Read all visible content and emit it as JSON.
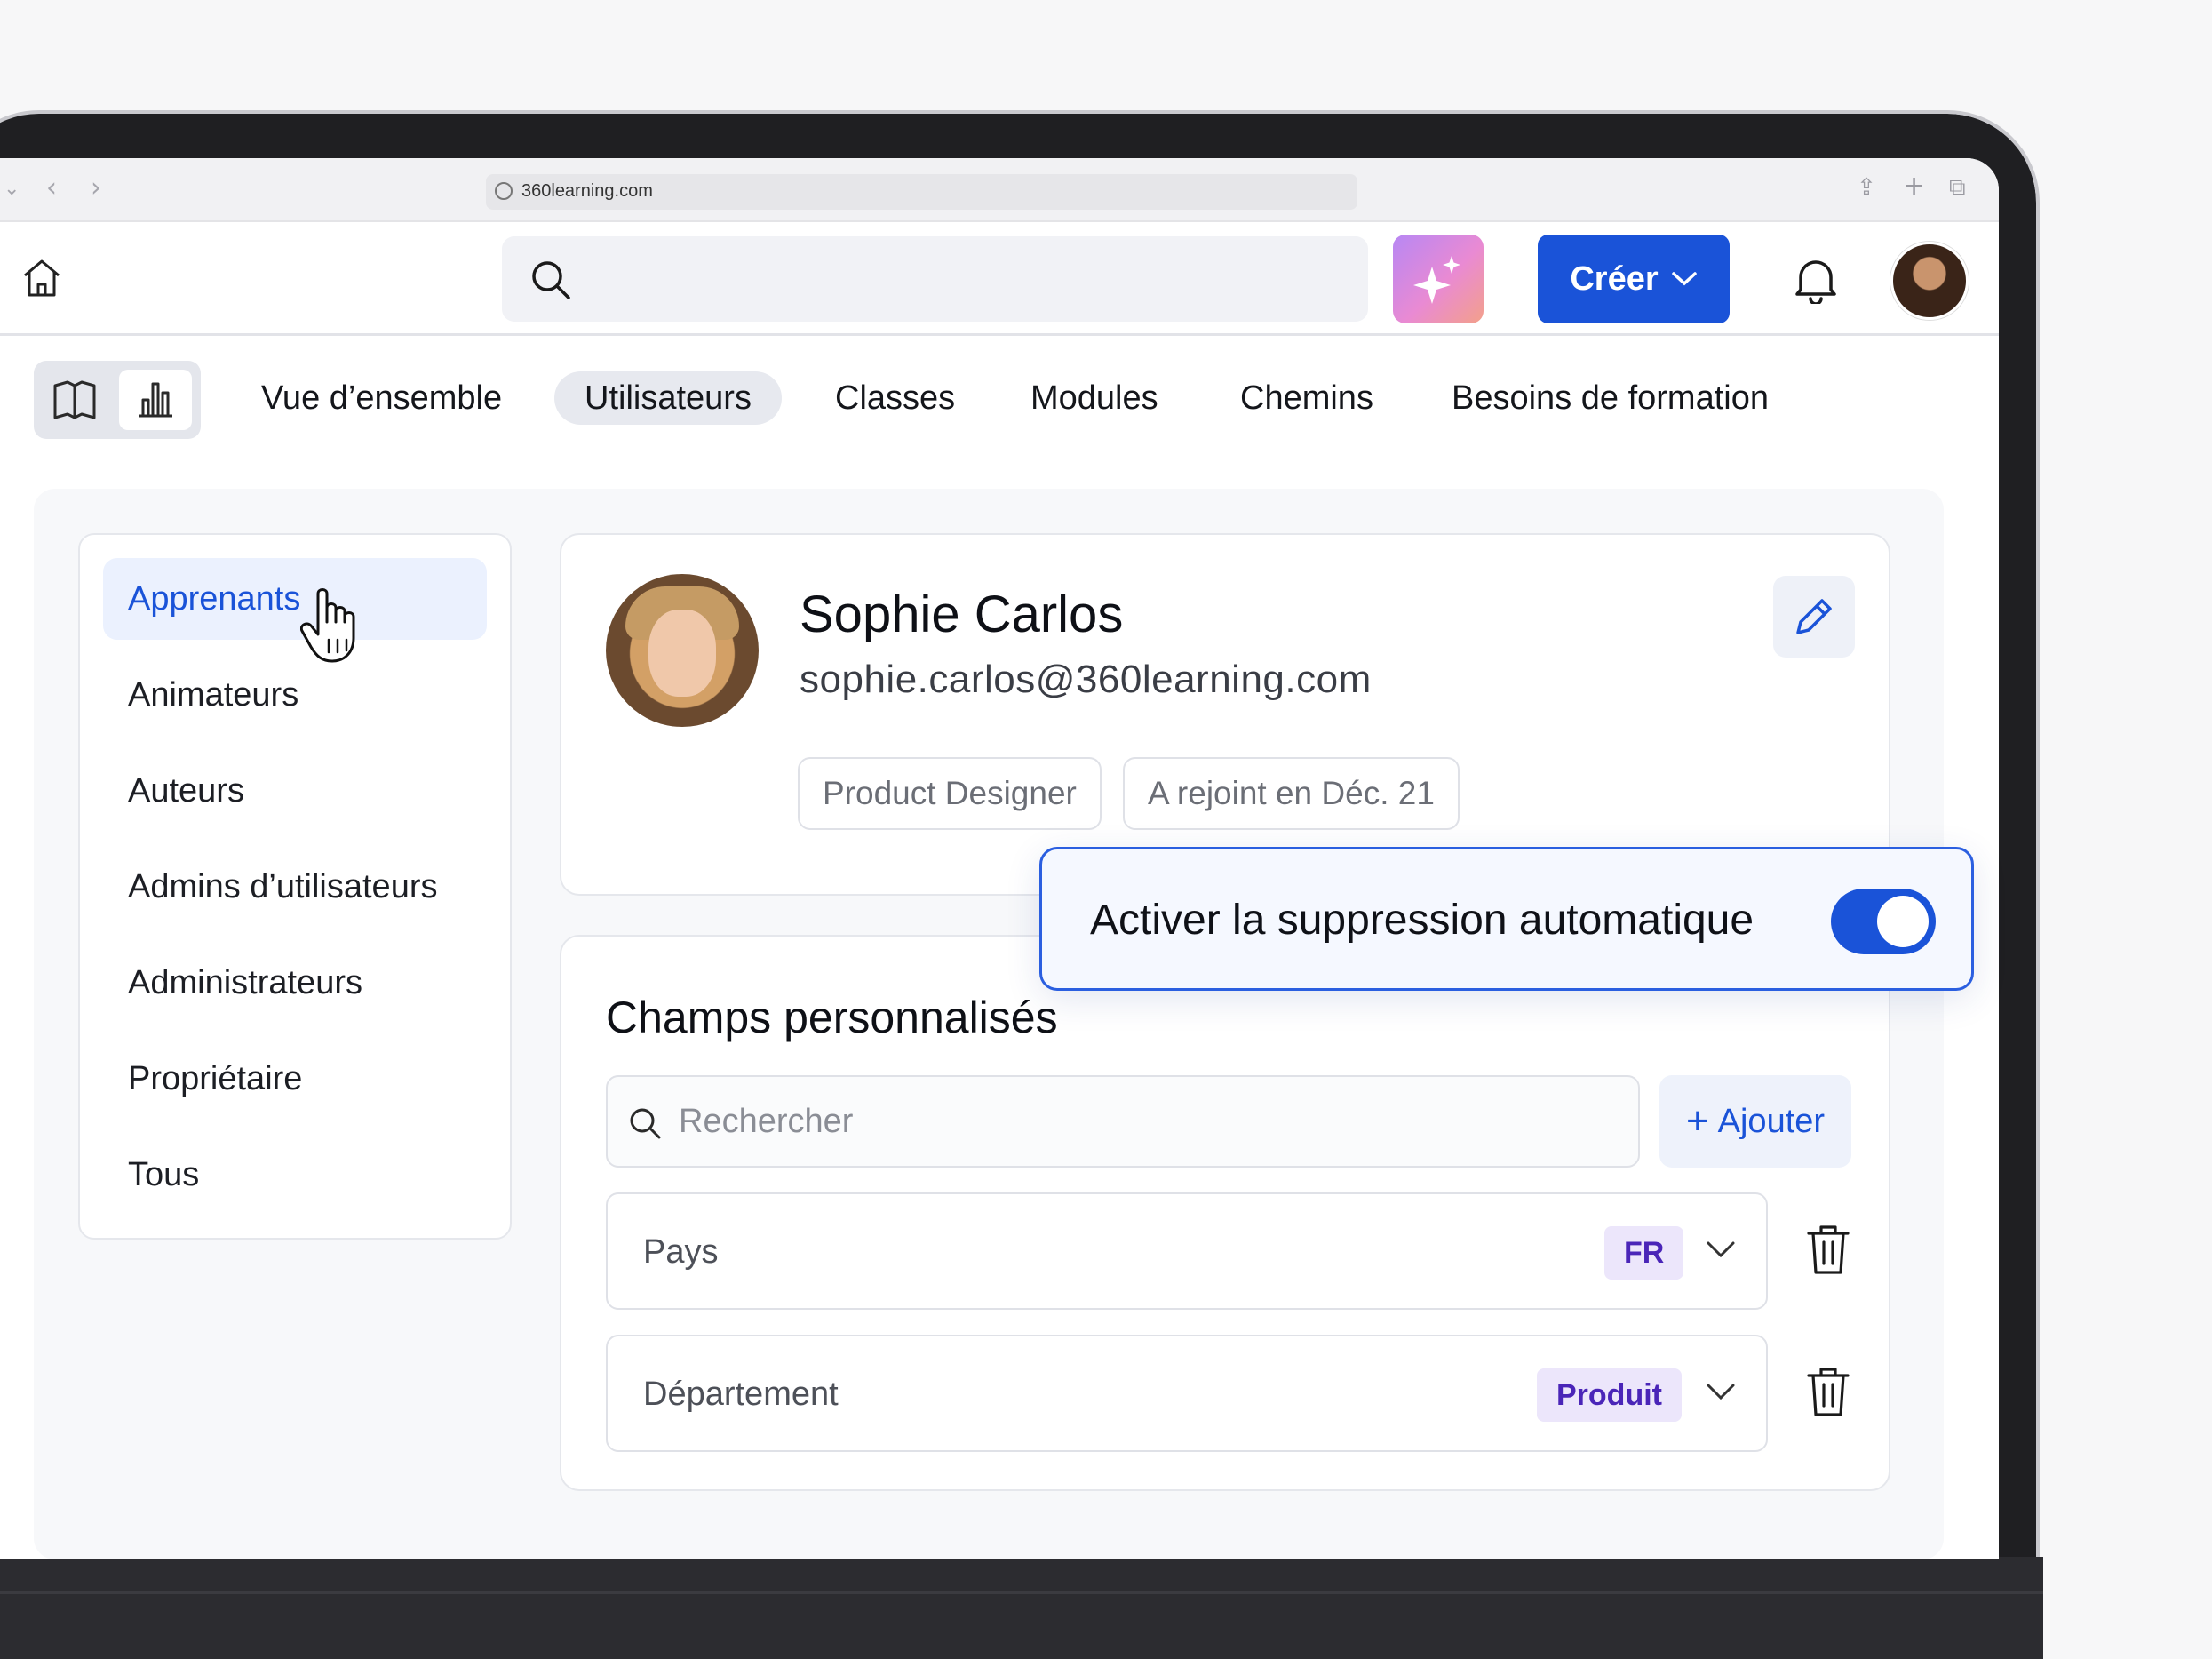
{
  "browser": {
    "url": "360learning.com"
  },
  "header": {
    "create_label": "Créer"
  },
  "tabs": [
    {
      "label": "Vue d’ensemble",
      "active": false
    },
    {
      "label": "Utilisateurs",
      "active": true
    },
    {
      "label": "Classes",
      "active": false
    },
    {
      "label": "Modules",
      "active": false
    },
    {
      "label": "Chemins",
      "active": false
    },
    {
      "label": "Besoins de formation",
      "active": false
    }
  ],
  "sidebar": {
    "items": [
      {
        "label": "Apprenants",
        "active": true
      },
      {
        "label": "Animateurs"
      },
      {
        "label": "Auteurs"
      },
      {
        "label": "Admins d’utilisateurs"
      },
      {
        "label": "Administrateurs"
      },
      {
        "label": "Propriétaire"
      },
      {
        "label": "Tous"
      }
    ]
  },
  "profile": {
    "name": "Sophie Carlos",
    "email": "sophie.carlos@360learning.com",
    "chips": [
      "Product Designer",
      "A rejoint en Déc. 21"
    ]
  },
  "toggle": {
    "label": "Activer la suppression automatique",
    "on": true
  },
  "custom_fields": {
    "title": "Champs personnalisés",
    "search_placeholder": "Rechercher",
    "add_label": "Ajouter",
    "rows": [
      {
        "label": "Pays",
        "value": "FR"
      },
      {
        "label": "Département",
        "value": "Produit"
      }
    ]
  },
  "colors": {
    "primary": "#1a53d8",
    "badge_bg": "#ece6fb",
    "badge_text": "#4a25b8"
  }
}
